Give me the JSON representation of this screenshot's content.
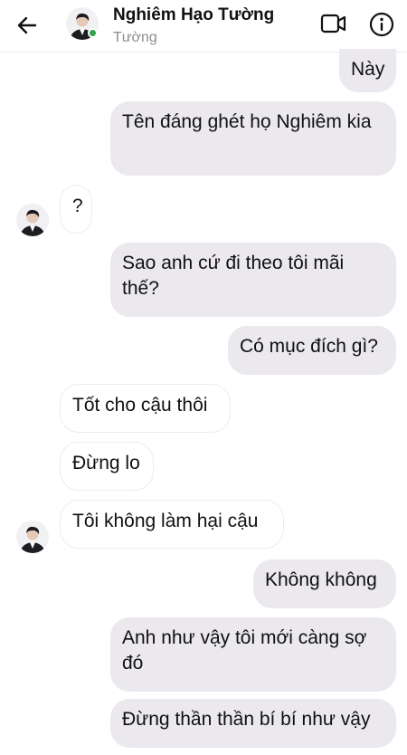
{
  "header": {
    "name": "Nghiêm Hạo Tường",
    "subtitle": "Tường",
    "back_icon": "back-arrow-icon",
    "video_icon": "video-camera-icon",
    "info_icon": "info-icon",
    "online_color": "#31a24c"
  },
  "colors": {
    "outgoing_bubble": "#ebe8ee",
    "incoming_bubble": "#ffffff"
  },
  "messages": [
    {
      "from": "me",
      "text": "Này"
    },
    {
      "from": "me",
      "text": "Tên đáng ghét họ Nghiêm kia"
    },
    {
      "from": "them",
      "text": "?"
    },
    {
      "from": "me",
      "text": "Sao anh cứ đi theo tôi mãi thế?"
    },
    {
      "from": "me",
      "text": "Có mục đích gì?"
    },
    {
      "from": "them",
      "text": "Tốt cho cậu thôi"
    },
    {
      "from": "them",
      "text": "Đừng lo"
    },
    {
      "from": "them",
      "text": "Tôi không làm hại cậu"
    },
    {
      "from": "me",
      "text": "Không không"
    },
    {
      "from": "me",
      "text": "Anh như vậy tôi mới càng sợ đó"
    },
    {
      "from": "me",
      "text": "Đừng thần thần bí bí như vậy"
    }
  ]
}
